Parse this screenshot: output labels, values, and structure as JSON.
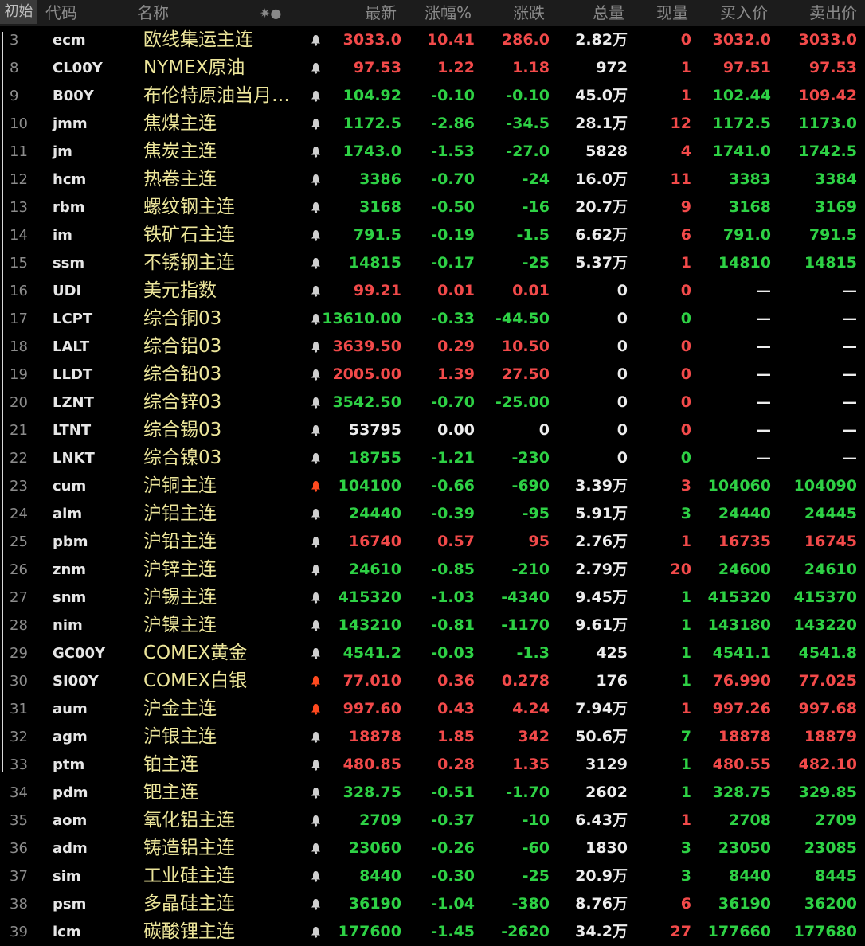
{
  "header": {
    "first_label": "初始",
    "columns": {
      "code": "代码",
      "name": "名称",
      "star": "✷●",
      "last": "最新",
      "pct": "涨幅%",
      "chg": "涨跌",
      "vol": "总量",
      "cur": "现量",
      "bid": "买入价",
      "ask": "卖出价"
    }
  },
  "colors": {
    "up": "#f24a4a",
    "down": "#2ed145",
    "flat": "#ededed",
    "name": "#ece59a",
    "alert_active": "#ff4a1f",
    "alert": "#cfcfcf"
  },
  "rows": [
    {
      "no": "3",
      "code": "ecm",
      "name": "欧线集运主连",
      "alert": false,
      "last": "3033.0",
      "pct": "10.41",
      "chg": "286.0",
      "vol": "2.82万",
      "cur": "0",
      "bid": "3032.0",
      "ask": "3033.0",
      "dir": "up",
      "cur_dir": "up",
      "bid_dir": "up",
      "ask_dir": "up"
    },
    {
      "no": "8",
      "code": "CL00Y",
      "name": "NYMEX原油",
      "alert": false,
      "last": "97.53",
      "pct": "1.22",
      "chg": "1.18",
      "vol": "972",
      "cur": "1",
      "bid": "97.51",
      "ask": "97.53",
      "dir": "up",
      "cur_dir": "up",
      "bid_dir": "up",
      "ask_dir": "up"
    },
    {
      "no": "9",
      "code": "B00Y",
      "name": "布伦特原油当月…",
      "alert": false,
      "last": "104.92",
      "pct": "-0.10",
      "chg": "-0.10",
      "vol": "45.0万",
      "cur": "1",
      "bid": "102.44",
      "ask": "109.42",
      "dir": "down",
      "cur_dir": "up",
      "bid_dir": "down",
      "ask_dir": "up"
    },
    {
      "no": "10",
      "code": "jmm",
      "name": "焦煤主连",
      "alert": false,
      "last": "1172.5",
      "pct": "-2.86",
      "chg": "-34.5",
      "vol": "28.1万",
      "cur": "12",
      "bid": "1172.5",
      "ask": "1173.0",
      "dir": "down",
      "cur_dir": "up",
      "bid_dir": "down",
      "ask_dir": "down"
    },
    {
      "no": "11",
      "code": "jm",
      "name": "焦炭主连",
      "alert": false,
      "last": "1743.0",
      "pct": "-1.53",
      "chg": "-27.0",
      "vol": "5828",
      "cur": "4",
      "bid": "1741.0",
      "ask": "1742.5",
      "dir": "down",
      "cur_dir": "up",
      "bid_dir": "down",
      "ask_dir": "down"
    },
    {
      "no": "12",
      "code": "hcm",
      "name": "热卷主连",
      "alert": false,
      "last": "3386",
      "pct": "-0.70",
      "chg": "-24",
      "vol": "16.0万",
      "cur": "11",
      "bid": "3383",
      "ask": "3384",
      "dir": "down",
      "cur_dir": "up",
      "bid_dir": "down",
      "ask_dir": "down"
    },
    {
      "no": "13",
      "code": "rbm",
      "name": "螺纹钢主连",
      "alert": false,
      "last": "3168",
      "pct": "-0.50",
      "chg": "-16",
      "vol": "20.7万",
      "cur": "9",
      "bid": "3168",
      "ask": "3169",
      "dir": "down",
      "cur_dir": "up",
      "bid_dir": "down",
      "ask_dir": "down"
    },
    {
      "no": "14",
      "code": "im",
      "name": "铁矿石主连",
      "alert": false,
      "last": "791.5",
      "pct": "-0.19",
      "chg": "-1.5",
      "vol": "6.62万",
      "cur": "6",
      "bid": "791.0",
      "ask": "791.5",
      "dir": "down",
      "cur_dir": "up",
      "bid_dir": "down",
      "ask_dir": "down"
    },
    {
      "no": "15",
      "code": "ssm",
      "name": "不锈钢主连",
      "alert": false,
      "last": "14815",
      "pct": "-0.17",
      "chg": "-25",
      "vol": "5.37万",
      "cur": "1",
      "bid": "14810",
      "ask": "14815",
      "dir": "down",
      "cur_dir": "up",
      "bid_dir": "down",
      "ask_dir": "down"
    },
    {
      "no": "16",
      "code": "UDI",
      "name": "美元指数",
      "alert": false,
      "last": "99.21",
      "pct": "0.01",
      "chg": "0.01",
      "vol": "0",
      "cur": "0",
      "bid": "—",
      "ask": "—",
      "dir": "up",
      "cur_dir": "up",
      "bid_dir": "flat",
      "ask_dir": "flat"
    },
    {
      "no": "17",
      "code": "LCPT",
      "name": "综合铜03",
      "alert": false,
      "last": "13610.00",
      "pct": "-0.33",
      "chg": "-44.50",
      "vol": "0",
      "cur": "0",
      "bid": "—",
      "ask": "—",
      "dir": "down",
      "cur_dir": "down",
      "bid_dir": "flat",
      "ask_dir": "flat"
    },
    {
      "no": "18",
      "code": "LALT",
      "name": "综合铝03",
      "alert": false,
      "last": "3639.50",
      "pct": "0.29",
      "chg": "10.50",
      "vol": "0",
      "cur": "0",
      "bid": "—",
      "ask": "—",
      "dir": "up",
      "cur_dir": "up",
      "bid_dir": "flat",
      "ask_dir": "flat"
    },
    {
      "no": "19",
      "code": "LLDT",
      "name": "综合铅03",
      "alert": false,
      "last": "2005.00",
      "pct": "1.39",
      "chg": "27.50",
      "vol": "0",
      "cur": "0",
      "bid": "—",
      "ask": "—",
      "dir": "up",
      "cur_dir": "up",
      "bid_dir": "flat",
      "ask_dir": "flat"
    },
    {
      "no": "20",
      "code": "LZNT",
      "name": "综合锌03",
      "alert": false,
      "last": "3542.50",
      "pct": "-0.70",
      "chg": "-25.00",
      "vol": "0",
      "cur": "0",
      "bid": "—",
      "ask": "—",
      "dir": "down",
      "cur_dir": "up",
      "bid_dir": "flat",
      "ask_dir": "flat"
    },
    {
      "no": "21",
      "code": "LTNT",
      "name": "综合锡03",
      "alert": false,
      "last": "53795",
      "pct": "0.00",
      "chg": "0",
      "vol": "0",
      "cur": "0",
      "bid": "—",
      "ask": "—",
      "dir": "flat",
      "cur_dir": "up",
      "bid_dir": "flat",
      "ask_dir": "flat"
    },
    {
      "no": "22",
      "code": "LNKT",
      "name": "综合镍03",
      "alert": false,
      "last": "18755",
      "pct": "-1.21",
      "chg": "-230",
      "vol": "0",
      "cur": "0",
      "bid": "—",
      "ask": "—",
      "dir": "down",
      "cur_dir": "down",
      "bid_dir": "flat",
      "ask_dir": "flat"
    },
    {
      "no": "23",
      "code": "cum",
      "name": "沪铜主连",
      "alert": true,
      "last": "104100",
      "pct": "-0.66",
      "chg": "-690",
      "vol": "3.39万",
      "cur": "3",
      "bid": "104060",
      "ask": "104090",
      "dir": "down",
      "cur_dir": "up",
      "bid_dir": "down",
      "ask_dir": "down"
    },
    {
      "no": "24",
      "code": "alm",
      "name": "沪铝主连",
      "alert": false,
      "last": "24440",
      "pct": "-0.39",
      "chg": "-95",
      "vol": "5.91万",
      "cur": "3",
      "bid": "24440",
      "ask": "24445",
      "dir": "down",
      "cur_dir": "down",
      "bid_dir": "down",
      "ask_dir": "down"
    },
    {
      "no": "25",
      "code": "pbm",
      "name": "沪铅主连",
      "alert": false,
      "last": "16740",
      "pct": "0.57",
      "chg": "95",
      "vol": "2.76万",
      "cur": "1",
      "bid": "16735",
      "ask": "16745",
      "dir": "up",
      "cur_dir": "up",
      "bid_dir": "up",
      "ask_dir": "up"
    },
    {
      "no": "26",
      "code": "znm",
      "name": "沪锌主连",
      "alert": false,
      "last": "24610",
      "pct": "-0.85",
      "chg": "-210",
      "vol": "2.79万",
      "cur": "20",
      "bid": "24600",
      "ask": "24610",
      "dir": "down",
      "cur_dir": "up",
      "bid_dir": "down",
      "ask_dir": "down"
    },
    {
      "no": "27",
      "code": "snm",
      "name": "沪锡主连",
      "alert": false,
      "last": "415320",
      "pct": "-1.03",
      "chg": "-4340",
      "vol": "9.45万",
      "cur": "1",
      "bid": "415320",
      "ask": "415370",
      "dir": "down",
      "cur_dir": "down",
      "bid_dir": "down",
      "ask_dir": "down"
    },
    {
      "no": "28",
      "code": "nim",
      "name": "沪镍主连",
      "alert": false,
      "last": "143210",
      "pct": "-0.81",
      "chg": "-1170",
      "vol": "9.61万",
      "cur": "1",
      "bid": "143180",
      "ask": "143220",
      "dir": "down",
      "cur_dir": "down",
      "bid_dir": "down",
      "ask_dir": "down"
    },
    {
      "no": "29",
      "code": "GC00Y",
      "name": "COMEX黄金",
      "alert": false,
      "last": "4541.2",
      "pct": "-0.03",
      "chg": "-1.3",
      "vol": "425",
      "cur": "1",
      "bid": "4541.1",
      "ask": "4541.8",
      "dir": "down",
      "cur_dir": "down",
      "bid_dir": "down",
      "ask_dir": "down"
    },
    {
      "no": "30",
      "code": "SI00Y",
      "name": "COMEX白银",
      "alert": true,
      "last": "77.010",
      "pct": "0.36",
      "chg": "0.278",
      "vol": "176",
      "cur": "1",
      "bid": "76.990",
      "ask": "77.025",
      "dir": "up",
      "cur_dir": "down",
      "bid_dir": "up",
      "ask_dir": "up"
    },
    {
      "no": "31",
      "code": "aum",
      "name": "沪金主连",
      "alert": true,
      "last": "997.60",
      "pct": "0.43",
      "chg": "4.24",
      "vol": "7.94万",
      "cur": "1",
      "bid": "997.26",
      "ask": "997.68",
      "dir": "up",
      "cur_dir": "up",
      "bid_dir": "up",
      "ask_dir": "up"
    },
    {
      "no": "32",
      "code": "agm",
      "name": "沪银主连",
      "alert": false,
      "last": "18878",
      "pct": "1.85",
      "chg": "342",
      "vol": "50.6万",
      "cur": "7",
      "bid": "18878",
      "ask": "18879",
      "dir": "up",
      "cur_dir": "down",
      "bid_dir": "up",
      "ask_dir": "up"
    },
    {
      "no": "33",
      "code": "ptm",
      "name": "铂主连",
      "alert": false,
      "last": "480.85",
      "pct": "0.28",
      "chg": "1.35",
      "vol": "3129",
      "cur": "1",
      "bid": "480.55",
      "ask": "482.10",
      "dir": "up",
      "cur_dir": "down",
      "bid_dir": "up",
      "ask_dir": "up"
    },
    {
      "no": "34",
      "code": "pdm",
      "name": "钯主连",
      "alert": false,
      "last": "328.75",
      "pct": "-0.51",
      "chg": "-1.70",
      "vol": "2602",
      "cur": "1",
      "bid": "328.75",
      "ask": "329.85",
      "dir": "down",
      "cur_dir": "down",
      "bid_dir": "down",
      "ask_dir": "down"
    },
    {
      "no": "35",
      "code": "aom",
      "name": "氧化铝主连",
      "alert": false,
      "last": "2709",
      "pct": "-0.37",
      "chg": "-10",
      "vol": "6.43万",
      "cur": "1",
      "bid": "2708",
      "ask": "2709",
      "dir": "down",
      "cur_dir": "up",
      "bid_dir": "down",
      "ask_dir": "down"
    },
    {
      "no": "36",
      "code": "adm",
      "name": "铸造铝主连",
      "alert": false,
      "last": "23060",
      "pct": "-0.26",
      "chg": "-60",
      "vol": "1830",
      "cur": "3",
      "bid": "23050",
      "ask": "23085",
      "dir": "down",
      "cur_dir": "down",
      "bid_dir": "down",
      "ask_dir": "down"
    },
    {
      "no": "37",
      "code": "sim",
      "name": "工业硅主连",
      "alert": false,
      "last": "8440",
      "pct": "-0.30",
      "chg": "-25",
      "vol": "20.9万",
      "cur": "3",
      "bid": "8440",
      "ask": "8445",
      "dir": "down",
      "cur_dir": "down",
      "bid_dir": "down",
      "ask_dir": "down"
    },
    {
      "no": "38",
      "code": "psm",
      "name": "多晶硅主连",
      "alert": false,
      "last": "36190",
      "pct": "-1.04",
      "chg": "-380",
      "vol": "8.76万",
      "cur": "6",
      "bid": "36190",
      "ask": "36200",
      "dir": "down",
      "cur_dir": "up",
      "bid_dir": "down",
      "ask_dir": "down"
    },
    {
      "no": "39",
      "code": "lcm",
      "name": "碳酸锂主连",
      "alert": false,
      "last": "177600",
      "pct": "-1.45",
      "chg": "-2620",
      "vol": "34.2万",
      "cur": "27",
      "bid": "177660",
      "ask": "177680",
      "dir": "down",
      "cur_dir": "up",
      "bid_dir": "down",
      "ask_dir": "down"
    }
  ]
}
